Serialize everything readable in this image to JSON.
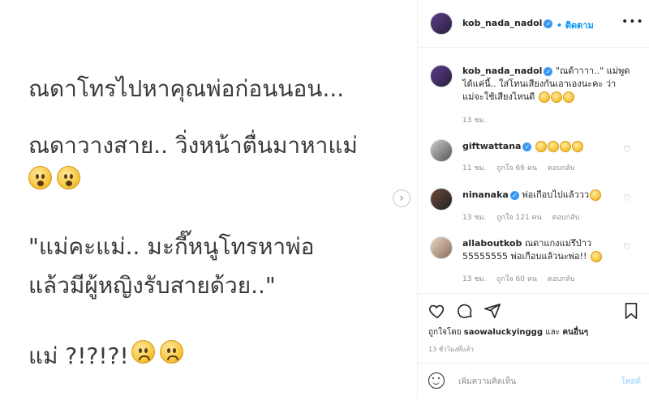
{
  "image": {
    "lines": [
      "ณดาโทรไปหาคุณพ่อก่อนนอน...",
      "ณดาวางสาย.. วิ่งหน้าตื่นมาหาแม่",
      "\"แม่คะแม่.. มะกี๊หนูโทรหาพ่อ",
      "แล้วมีผู้หญิงรับสายด้วย..\"",
      "แม่ ?!?!?!"
    ],
    "next_icon": "chevron-right-icon",
    "next_glyph": "›"
  },
  "header": {
    "username": "kob_nada_nadol",
    "dot": "•",
    "follow_label": "ติดตาม",
    "more_glyph": "•••"
  },
  "caption": {
    "username": "kob_nada_nadol",
    "text_line1": "\"ณด้าาาา..\" แม่พูด",
    "text_line2": "ได้แค่นี้.. ใส่โทนเสียงกันเอาเองนะคะ ว่า",
    "text_line3": "แม่จะใช้เสียงไหนดี",
    "time": "13 ชม."
  },
  "comments": [
    {
      "username": "giftwattana",
      "text": "",
      "time": "11 ชม.",
      "likes": "ถูกใจ 66 คน",
      "reply": "ตอบกลับ"
    },
    {
      "username": "ninanaka",
      "text": "พ่อเกือบไปแล้ววว",
      "time": "13 ชม.",
      "likes": "ถูกใจ 121 คน",
      "reply": "ตอบกลับ"
    },
    {
      "username": "allaboutkob",
      "text": "ณดาแกงแม่รึป่าว",
      "text2": "55555555 พ่อเกือบแล้วนะพ่อ!!",
      "time": "13 ชม.",
      "likes": "ถูกใจ 60 คน",
      "reply": "ตอบกลับ"
    }
  ],
  "actions": {
    "liked_prefix": "ถูกใจโดย",
    "liked_user": "saowaluckyinggg",
    "liked_and": "และ",
    "liked_others": "คนอื่นๆ",
    "ago": "13 ชั่วโมงที่แล้ว",
    "comment_placeholder": "เพิ่มความคิดเห็น",
    "post_label": "โพสต์"
  },
  "colors": {
    "accent": "#0095f6",
    "verified": "#3897f0",
    "muted": "#8e8e8e"
  }
}
